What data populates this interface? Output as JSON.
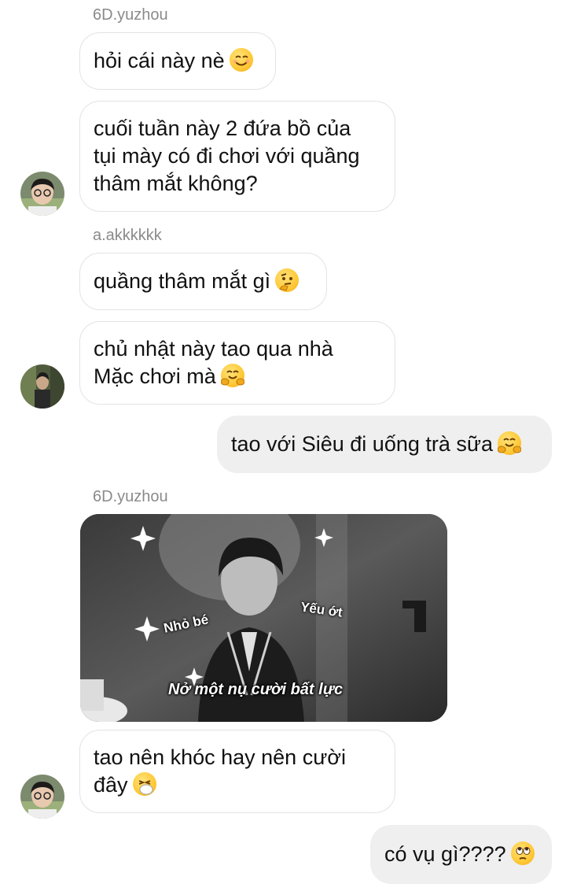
{
  "conversation": {
    "group1": {
      "sender": "6D.yuzhou",
      "msg1": "hỏi cái này nè",
      "msg1_emoji": "smiling-face-icon",
      "msg2_line1": "cuối tuần này 2 đứa bồ của",
      "msg2_line2": "tụi mày có đi chơi với quầng",
      "msg2_line3": "thâm mắt không?"
    },
    "group2": {
      "sender": "a.akkkkkk",
      "msg1": "quầng thâm mắt gì",
      "msg1_emoji": "thinking-face-icon",
      "msg2_line1": "chủ nhật này tao qua nhà",
      "msg2_line2": "Mặc chơi mà",
      "msg2_emoji": "hugging-face-icon"
    },
    "outgoing1": {
      "text": "tao với Siêu đi uống trà sữa",
      "emoji": "hugging-face-icon"
    },
    "group3": {
      "sender": "6D.yuzhou",
      "image": {
        "caption_left": "Nhỏ bé",
        "caption_right": "Yếu ớt",
        "caption_bottom": "Nở một nụ cười bất lực"
      },
      "msg1_line1": "tao nên khóc hay nên cười",
      "msg1_line2": "đây",
      "msg1_emoji": "sneezing-face-icon"
    },
    "outgoing2": {
      "text": "có vụ gì????",
      "emoji": "eye-roll-face-icon"
    }
  },
  "colors": {
    "incoming_border": "#e3e3e3",
    "outgoing_bg": "#efefef",
    "sender_text": "#8a8a8a"
  }
}
